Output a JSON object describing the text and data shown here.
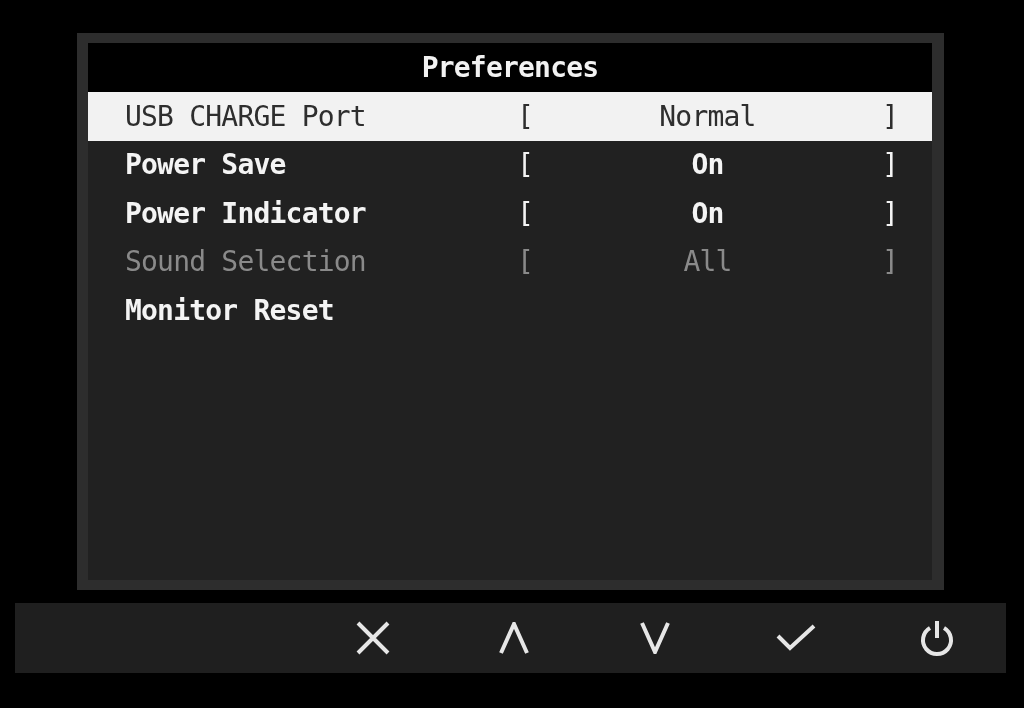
{
  "menu": {
    "title": "Preferences",
    "items": [
      {
        "kind": "setting",
        "label": "USB CHARGE Port",
        "left_bracket": "[",
        "value": "Normal",
        "right_bracket": "]",
        "selected": true,
        "disabled": false
      },
      {
        "kind": "setting",
        "label": "Power Save",
        "left_bracket": "[",
        "value": "On",
        "right_bracket": "]",
        "selected": false,
        "disabled": false
      },
      {
        "kind": "setting",
        "label": "Power Indicator",
        "left_bracket": "[",
        "value": "On",
        "right_bracket": "]",
        "selected": false,
        "disabled": false
      },
      {
        "kind": "setting",
        "label": "Sound Selection",
        "left_bracket": "[",
        "value": "All",
        "right_bracket": "]",
        "selected": false,
        "disabled": true
      },
      {
        "kind": "action",
        "label": "Monitor Reset",
        "selected": false,
        "disabled": false
      }
    ]
  }
}
